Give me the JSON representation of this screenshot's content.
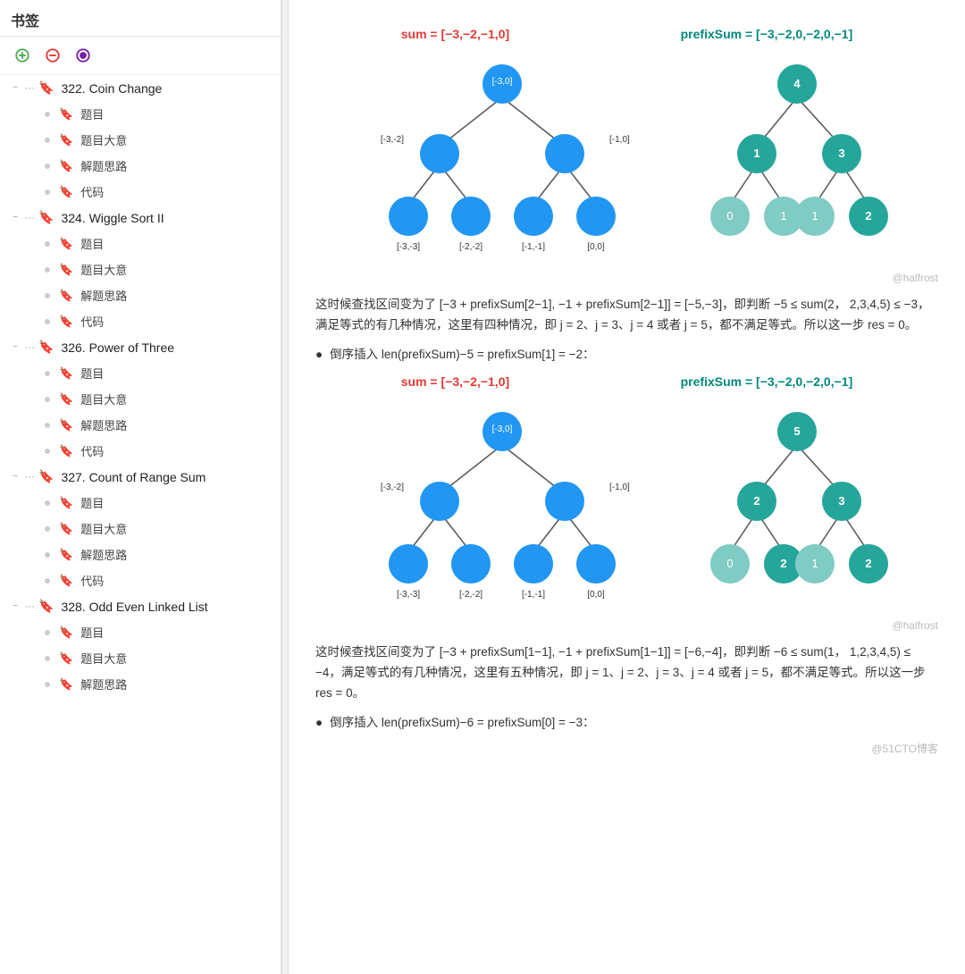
{
  "sidebar": {
    "header": "书签",
    "toolbar": [
      {
        "icon": "+",
        "color": "green",
        "label": "add-bookmark"
      },
      {
        "icon": "✕",
        "color": "red",
        "label": "remove-bookmark"
      },
      {
        "icon": "◉",
        "color": "purple",
        "label": "filter-bookmark"
      }
    ],
    "chapters": [
      {
        "id": "322",
        "title": "322. Coin Change",
        "collapsed": false,
        "subitems": [
          "题目",
          "题目大意",
          "解题思路",
          "代码"
        ]
      },
      {
        "id": "324",
        "title": "324. Wiggle Sort II",
        "collapsed": false,
        "subitems": [
          "题目",
          "题目大意",
          "解题思路",
          "代码"
        ]
      },
      {
        "id": "326",
        "title": "326. Power of Three",
        "collapsed": false,
        "subitems": [
          "题目",
          "题目大意",
          "解题思路",
          "代码"
        ]
      },
      {
        "id": "327",
        "title": "327. Count of Range Sum",
        "collapsed": false,
        "subitems": [
          "题目",
          "题目大意",
          "解题思路",
          "代码"
        ]
      },
      {
        "id": "328",
        "title": "328. Odd Even Linked List",
        "collapsed": false,
        "subitems": [
          "题目",
          "题目大意",
          "解题思路"
        ]
      }
    ]
  },
  "main": {
    "diagram1": {
      "sum_label": "sum = [−3,−2,−1,0]",
      "prefix_label": "prefixSum = [−3,−2,0,−2,0,−1]",
      "watermark": "@halfrost"
    },
    "para1": "这时候查找区间变为了 [−3 + prefixSum[2−1], −1 + prefixSum[2−1]] = [−5,−3]，即判断 −5 ≤ sum(2， 2,3,4,5) ≤ −3，满足等式的有几种情况，这里有四种情况，即 j = 2、j = 3、j = 4 或者 j = 5，都不满足等式。所以这一步 res = 0。",
    "bullet1": "倒序插入 len(prefixSum)−5 = prefixSum[1] = −2：",
    "diagram2": {
      "sum_label": "sum = [−3,−2,−1,0]",
      "prefix_label": "prefixSum = [−3,−2,0,−2,0,−1]",
      "watermark": "@halfrost"
    },
    "para2": "这时候查找区间变为了 [−3 + prefixSum[1−1], −1 + prefixSum[1−1]] = [−6,−4]，即判断 −6 ≤ sum(1， 1,2,3,4,5) ≤ −4，满足等式的有几种情况，这里有五种情况，即 j = 1、j = 2、j = 3、j = 4 或者 j = 5，都不满足等式。所以这一步 res = 0。",
    "bullet2": "倒序插入 len(prefixSum)−6 = prefixSum[0] = −3："
  }
}
